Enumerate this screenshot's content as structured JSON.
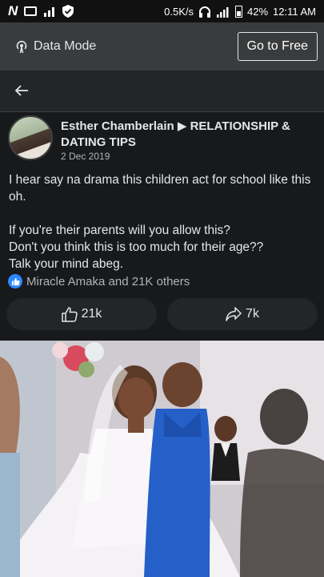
{
  "status_bar": {
    "net_speed": "0.5K/s",
    "battery_pct": "42%",
    "time": "12:11 AM",
    "icons": [
      "n-logo-icon",
      "image-icon",
      "signal-icon",
      "shield-icon",
      "headphones-icon",
      "signal-icon",
      "battery-icon"
    ]
  },
  "data_mode": {
    "label": "Data Mode",
    "go_free_label": "Go to Free"
  },
  "post": {
    "author": "Esther Chamberlain ▶ RELATIONSHIP & DATING TIPS",
    "date": "2 Dec 2019",
    "text": {
      "line1": "I hear say  na drama this children act for school like this oh.",
      "line2": "If you're their parents will you allow this?",
      "line3": "Don't you think this is too much for their age??",
      "line4": "Talk your mind abeg."
    },
    "reactions_text": "Miracle Amaka and 21K others",
    "like_count": "21k",
    "share_count": "7k"
  },
  "colors": {
    "background": "#18191a",
    "bar": "#3a3b3c",
    "card": "#242526",
    "accent": "#2d88ff",
    "text": "#e4e6eb",
    "muted": "#b0b3b8"
  }
}
